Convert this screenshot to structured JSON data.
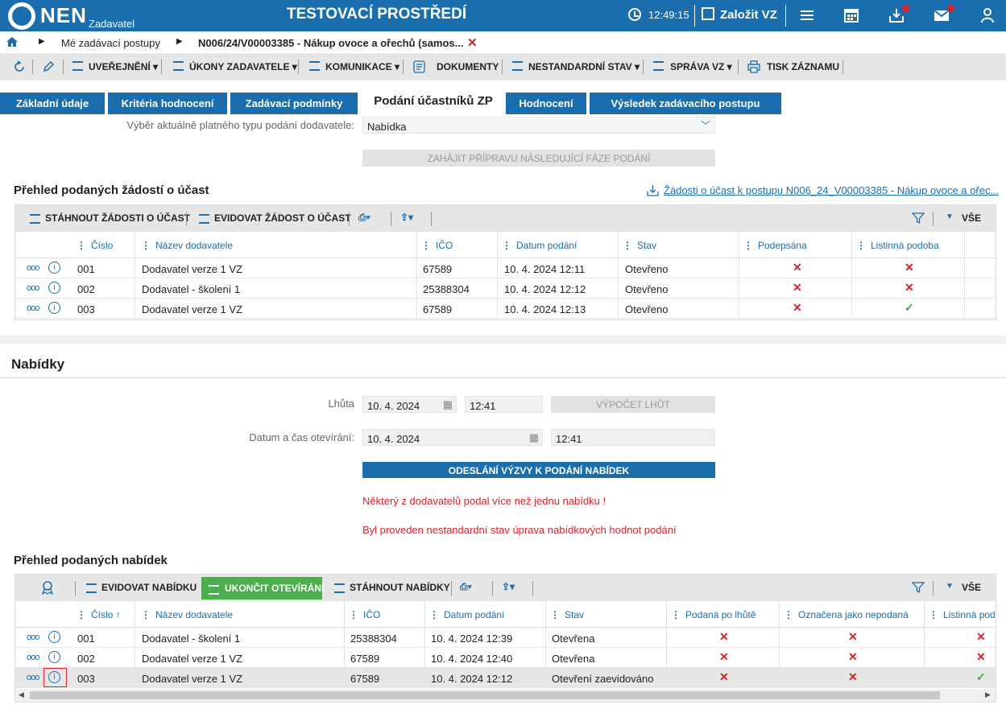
{
  "header": {
    "logo": "NEN",
    "logo_sub": "Zadavatel",
    "env_title": "TESTOVACÍ PROSTŘEDÍ",
    "clock": "12:49:15",
    "new_vz": "Založit VZ"
  },
  "breadcrumb": {
    "item1": "Mé zadávací postupy",
    "item2": "N006/24/V00003385 - Nákup ovoce a ořechů (samos..."
  },
  "toolbar": {
    "uverejneni": "UVEŘEJNĚNÍ ▾",
    "ukony": "ÚKONY ZADAVATELE ▾",
    "komunikace": "KOMUNIKACE ▾",
    "dokumenty": "DOKUMENTY",
    "nestandardni": "NESTANDARDNÍ STAV ▾",
    "sprava": "SPRÁVA VZ ▾",
    "tisk": "TISK ZÁZNAMU"
  },
  "tabs": [
    "Základní údaje",
    "Kritéria hodnocení",
    "Zadávací podmínky",
    "Podání účastníků ZP",
    "Hodnocení",
    "Výsledek zadávacího postupu"
  ],
  "submission": {
    "type_label": "Výběr aktuálně platného typu podání dodavatele:",
    "type_value": "Nabídka",
    "next_phase_btn": "ZAHÁJIT PŘÍPRAVU NÁSLEDUJÍCÍ FÁZE PODÁNÍ"
  },
  "requests": {
    "title": "Přehled podaných žádostí o účast",
    "export_link": "Žádosti o účast k postupu N006_24_V00003385 - Nákup ovoce a ořec...",
    "btn_download": "STÁHNOUT ŽÁDOSTI O ÚČAST",
    "btn_register": "EVIDOVAT ŽÁDOST O ÚČAST",
    "all_label": "VŠE",
    "columns": [
      "Číslo",
      "Název dodavatele",
      "IČO",
      "Datum podání",
      "Stav",
      "Podepsána",
      "Listinná podoba"
    ],
    "rows": [
      {
        "cislo": "001",
        "nazev": "Dodavatel verze 1 VZ",
        "ico": "67589",
        "datum": "10. 4. 2024 12:11",
        "stav": "Otevřeno",
        "podepsana": "✕",
        "listinna": "✕"
      },
      {
        "cislo": "002",
        "nazev": "Dodavatel - školení 1",
        "ico": "25388304",
        "datum": "10. 4. 2024 12:12",
        "stav": "Otevřeno",
        "podepsana": "✕",
        "listinna": "✕"
      },
      {
        "cislo": "003",
        "nazev": "Dodavatel verze 1 VZ",
        "ico": "67589",
        "datum": "10. 4. 2024 12:13",
        "stav": "Otevřeno",
        "podepsana": "✕",
        "listinna": "✓"
      }
    ]
  },
  "offers": {
    "title": "Nabídky",
    "deadline_label": "Lhůta",
    "deadline_date": "10. 4. 2024",
    "deadline_time": "12:41",
    "calc_btn": "VÝPOČET LHŮT",
    "opening_label": "Datum a čas otevírání:",
    "opening_date": "10. 4. 2024",
    "opening_time": "12:41",
    "send_btn": "ODESLÁNÍ VÝZVY K PODÁNÍ NABÍDEK",
    "warning1": "Některý z dodavatelů podal více než jednu nabídku !",
    "warning2": "Byl proveden nestandardní stav úprava nabídkových hodnot podání"
  },
  "offers_grid": {
    "title": "Přehled podaných nabídek",
    "btn_register": "EVIDOVAT NABÍDKU",
    "btn_finish": "UKONČIT OTEVÍRÁNÍ",
    "btn_download": "STÁHNOUT NABÍDKY",
    "all_label": "VŠE",
    "columns": [
      "Číslo ↑",
      "Název dodavatele",
      "IČO",
      "Datum podání",
      "Stav",
      "Podaná po lhůtě",
      "Označena jako nepodaná",
      "Listinná pod"
    ],
    "rows": [
      {
        "cislo": "001",
        "nazev": "Dodavatel - školení 1",
        "ico": "25388304",
        "datum": "10. 4. 2024 12:39",
        "stav": "Otevřena",
        "po_lhute": "✕",
        "nepodana": "✕",
        "listinna": "✕"
      },
      {
        "cislo": "002",
        "nazev": "Dodavatel verze 1 VZ",
        "ico": "67589",
        "datum": "10. 4. 2024 12:40",
        "stav": "Otevřena",
        "po_lhute": "✕",
        "nepodana": "✕",
        "listinna": "✕"
      },
      {
        "cislo": "003",
        "nazev": "Dodavatel verze 1 VZ",
        "ico": "67589",
        "datum": "10. 4. 2024 12:12",
        "stav": "Otevření zaevidováno",
        "po_lhute": "✕",
        "nepodana": "✕",
        "listinna": "✓"
      }
    ]
  }
}
